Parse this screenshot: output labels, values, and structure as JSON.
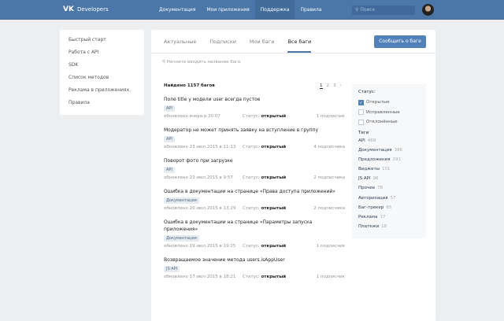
{
  "header": {
    "logo_text": "Developers",
    "nav": [
      "Документация",
      "Мои приложения",
      "Поддержка",
      "Правила"
    ],
    "active_nav": 2,
    "search_placeholder": "Поиск"
  },
  "sidebar": [
    "Быстрый старт",
    "Работа с API",
    "SDK",
    "Список методов",
    "Реклама в приложениях",
    "Правила"
  ],
  "tabs": [
    "Актуальные",
    "Подписки",
    "Мои баги",
    "Все баги"
  ],
  "report_button": "Сообщить о баге",
  "search_placeholder": "Начните вводить название бага",
  "found": "Найдено 1157 багов",
  "pages": [
    "1",
    "2",
    "3",
    "›"
  ],
  "bugs": [
    {
      "title": "Поле title у модели user всегда пустое",
      "tag": "API",
      "date": "обновлено вчера в 20:07",
      "status_label": "Статус:",
      "status": "открытый",
      "subs": "1 подписчик"
    },
    {
      "title": "Модератор не может принять заявку на вступление в группу",
      "tag": "API",
      "date": "обновлено 23 июл 2015 в 11:13",
      "status_label": "Статус:",
      "status": "открытый",
      "subs": "4 подписчика"
    },
    {
      "title": "Поворот фото при загрузке",
      "tag": "API",
      "date": "обновлено 23 июл 2015 в 9:57",
      "status_label": "Статус:",
      "status": "открытый",
      "subs": "2 подписчика"
    },
    {
      "title": "Ошибка в документации на странице «Права доступа приложений»",
      "tag": "Документация",
      "date": "обновлено 20 июл 2015 в 13:29",
      "status_label": "Статус:",
      "status": "открытый",
      "subs": "2 подписчика"
    },
    {
      "title": "Ошибка в документации на странице «Параметры запуска приложения»",
      "tag": "Документация",
      "date": "обновлено 19 июл 2015 в 19:25",
      "status_label": "Статус:",
      "status": "открытый",
      "subs": "1 подписчик"
    },
    {
      "title": "Возвращаемое значение метода users.isAppUser",
      "tag": "JS API",
      "date": "обновлено 17 июл 2015 в 18:21",
      "status_label": "Статус:",
      "status": "открытый",
      "subs": "1 подписчик"
    }
  ],
  "filters": {
    "status_heading": "Статус:",
    "statuses": [
      {
        "label": "Открытые",
        "checked": true
      },
      {
        "label": "Исправленные",
        "checked": false
      },
      {
        "label": "Отклонённые",
        "checked": false
      }
    ],
    "tags_heading": "Теги",
    "tags": [
      {
        "name": "API",
        "count": "469"
      },
      {
        "name": "Документация",
        "count": "386"
      },
      {
        "name": "Предложения",
        "count": "291"
      },
      {
        "name": "Виджеты",
        "count": "101"
      },
      {
        "name": "JS API",
        "count": "96"
      },
      {
        "name": "Прочее",
        "count": "78"
      },
      {
        "name": "Авторизация",
        "count": "57"
      },
      {
        "name": "Баг-трекер",
        "count": "65"
      },
      {
        "name": "Реклама",
        "count": "17"
      },
      {
        "name": "Платежи",
        "count": "18"
      }
    ]
  }
}
